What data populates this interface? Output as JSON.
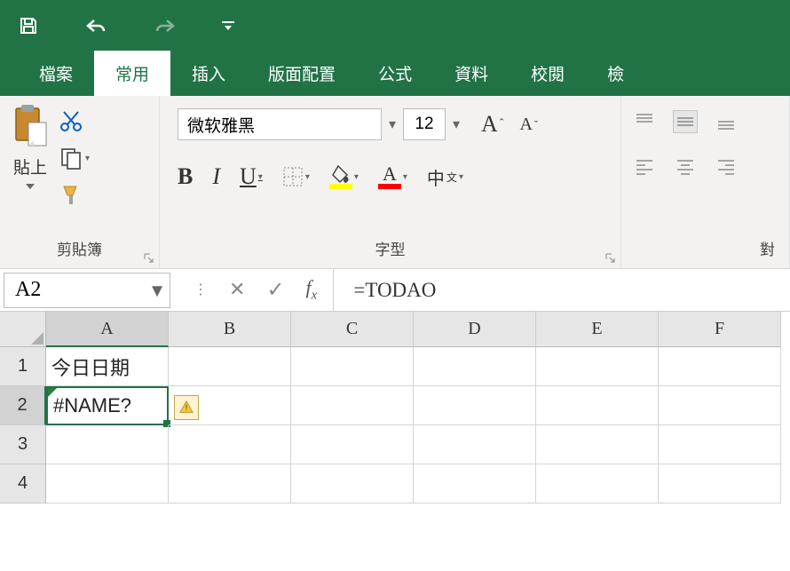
{
  "titlebar": {
    "icons": {
      "save": "save-icon",
      "undo": "undo-icon",
      "redo": "redo-icon",
      "customize": "customize-icon"
    }
  },
  "tabs": {
    "items": [
      "檔案",
      "常用",
      "插入",
      "版面配置",
      "公式",
      "資料",
      "校閱",
      "檢"
    ],
    "active_index": 1
  },
  "ribbon": {
    "clipboard": {
      "paste_label": "貼上",
      "group_label": "剪貼簿"
    },
    "font": {
      "name": "微软雅黑",
      "size": "12",
      "group_label": "字型"
    },
    "alignment": {
      "group_label": "對"
    }
  },
  "formula_bar": {
    "name_box": "A2",
    "formula": "=TODAO"
  },
  "grid": {
    "col_headers": [
      "A",
      "B",
      "C",
      "D",
      "E",
      "F"
    ],
    "row_headers": [
      "1",
      "2",
      "3",
      "4"
    ],
    "active_col_index": 0,
    "active_row_index": 1,
    "cells": {
      "A1": "今日日期",
      "A2": "#NAME?"
    }
  }
}
